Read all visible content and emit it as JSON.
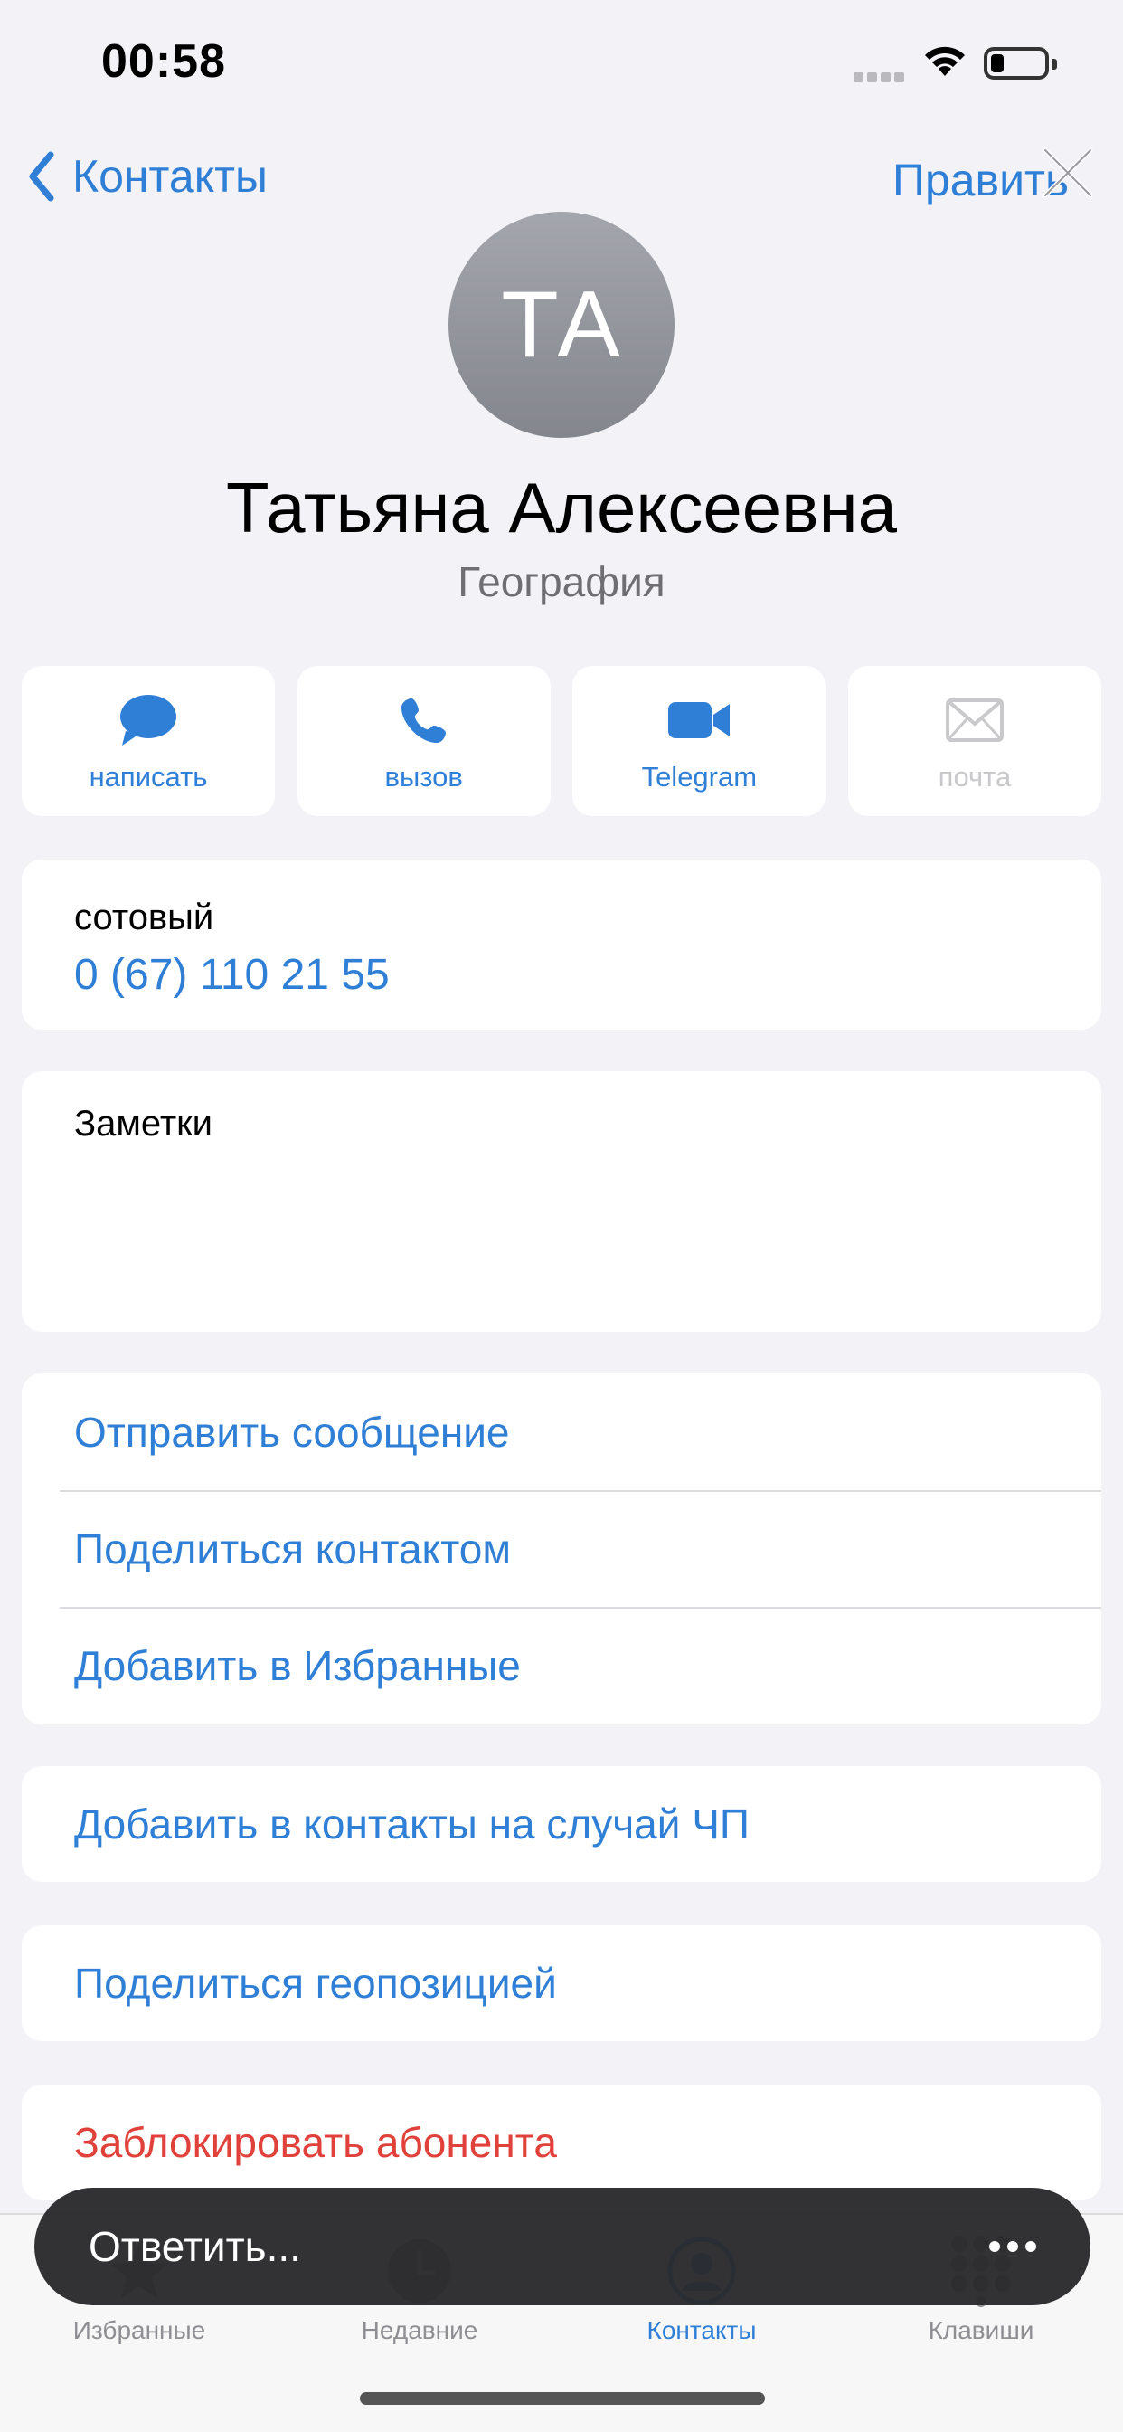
{
  "status": {
    "time": "00:58"
  },
  "nav": {
    "back_label": "Контакты",
    "edit_label": "Править"
  },
  "contact": {
    "initials": "ТА",
    "name": "Татьяна Алексеевна",
    "subtitle": "География"
  },
  "actions": [
    {
      "label": "написать",
      "icon": "message-icon"
    },
    {
      "label": "вызов",
      "icon": "phone-icon"
    },
    {
      "label": "Telegram",
      "icon": "video-icon"
    },
    {
      "label": "почта",
      "icon": "mail-icon",
      "disabled": true
    }
  ],
  "phone": {
    "label": "сотовый",
    "number": "0 (67) 110 21 55"
  },
  "notes": {
    "label": "Заметки"
  },
  "list": [
    "Отправить сообщение",
    "Поделиться контактом",
    "Добавить в Избранные"
  ],
  "emergency": "Добавить в контакты на случай ЧП",
  "share_location": "Поделиться геопозицией",
  "block": "Заблокировать абонента",
  "tabs": [
    {
      "label": "Избранные",
      "icon": "star-icon"
    },
    {
      "label": "Недавние",
      "icon": "clock-icon"
    },
    {
      "label": "Контакты",
      "icon": "person-icon",
      "active": true
    },
    {
      "label": "Клавиши",
      "icon": "keypad-icon"
    }
  ],
  "reply": {
    "placeholder": "Ответить..."
  },
  "colors": {
    "accent": "#2f7fd6",
    "danger": "#e0413a",
    "background": "#f2f2f7"
  }
}
